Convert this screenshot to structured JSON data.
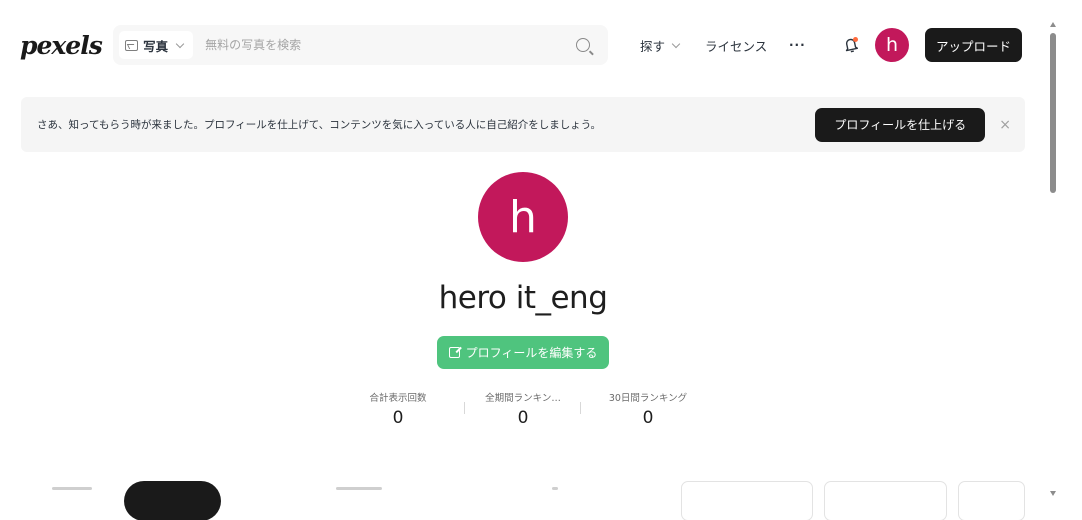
{
  "header": {
    "logo": "pexels",
    "search": {
      "type_label": "写真",
      "placeholder": "無料の写真を検索"
    },
    "nav": {
      "explore": "探す",
      "license": "ライセンス",
      "more": "···"
    },
    "avatar_letter": "h",
    "upload_label": "アップロード"
  },
  "banner": {
    "text": "さあ、知ってもらう時が来ました。プロフィールを仕上げて、コンテンツを気に入っている人に自己紹介をしましょう。",
    "button_label": "プロフィールを仕上げる",
    "close": "×"
  },
  "profile": {
    "avatar_letter": "h",
    "name": "hero it_eng",
    "edit_label": "プロフィールを編集する",
    "stats": [
      {
        "label": "合計表示回数",
        "value": "0"
      },
      {
        "label": "全期間ランキン…",
        "value": "0"
      },
      {
        "label": "30日間ランキング",
        "value": "0"
      }
    ]
  },
  "colors": {
    "avatar": "#c2185b",
    "edit_button": "#4fc47e",
    "dark_button": "#1a1a1a"
  }
}
